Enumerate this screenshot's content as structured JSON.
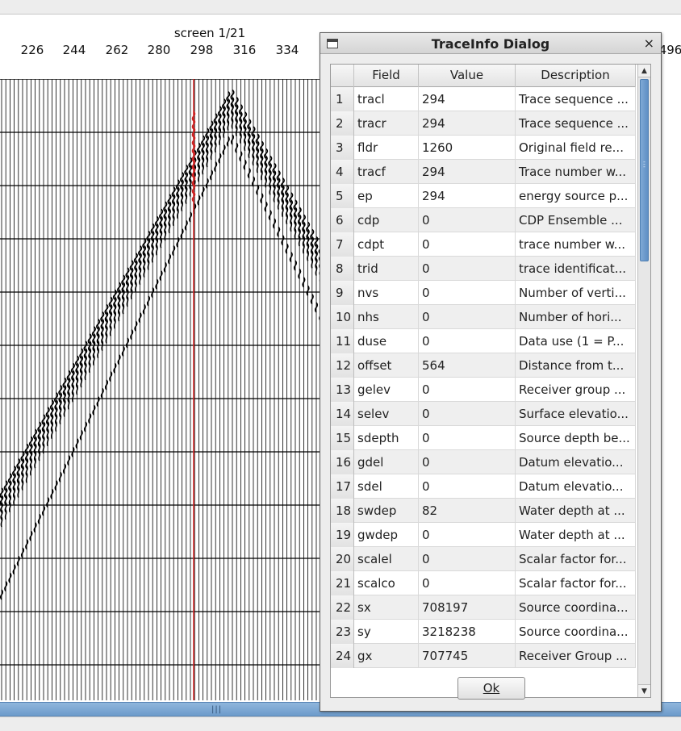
{
  "screen": {
    "title": "screen 1/21"
  },
  "axis": {
    "ticks": [
      "226",
      "244",
      "262",
      "280",
      "298",
      "316",
      "334",
      "496"
    ]
  },
  "dialog": {
    "title": "TraceInfo Dialog",
    "close_glyph": "×",
    "columns": [
      "Field",
      "Value",
      "Description"
    ],
    "rows": [
      {
        "n": "1",
        "field": "tracl",
        "value": "294",
        "desc": "Trace sequence ..."
      },
      {
        "n": "2",
        "field": "tracr",
        "value": "294",
        "desc": "Trace sequence ..."
      },
      {
        "n": "3",
        "field": "fldr",
        "value": "1260",
        "desc": "Original field re..."
      },
      {
        "n": "4",
        "field": "tracf",
        "value": "294",
        "desc": "Trace number w..."
      },
      {
        "n": "5",
        "field": "ep",
        "value": "294",
        "desc": "energy source p..."
      },
      {
        "n": "6",
        "field": "cdp",
        "value": "0",
        "desc": "CDP Ensemble ..."
      },
      {
        "n": "7",
        "field": "cdpt",
        "value": "0",
        "desc": "trace number w..."
      },
      {
        "n": "8",
        "field": "trid",
        "value": "0",
        "desc": "trace identificat..."
      },
      {
        "n": "9",
        "field": "nvs",
        "value": "0",
        "desc": "Number of verti..."
      },
      {
        "n": "10",
        "field": "nhs",
        "value": "0",
        "desc": "Number of hori..."
      },
      {
        "n": "11",
        "field": "duse",
        "value": "0",
        "desc": "Data use (1 = P..."
      },
      {
        "n": "12",
        "field": "offset",
        "value": "564",
        "desc": "Distance from t..."
      },
      {
        "n": "13",
        "field": "gelev",
        "value": "0",
        "desc": "Receiver group ..."
      },
      {
        "n": "14",
        "field": "selev",
        "value": "0",
        "desc": "Surface elevatio..."
      },
      {
        "n": "15",
        "field": "sdepth",
        "value": "0",
        "desc": "Source depth be..."
      },
      {
        "n": "16",
        "field": "gdel",
        "value": "0",
        "desc": "Datum elevatio..."
      },
      {
        "n": "17",
        "field": "sdel",
        "value": "0",
        "desc": "Datum elevatio..."
      },
      {
        "n": "18",
        "field": "swdep",
        "value": "82",
        "desc": "Water depth at ..."
      },
      {
        "n": "19",
        "field": "gwdep",
        "value": "0",
        "desc": "Water depth at ..."
      },
      {
        "n": "20",
        "field": "scalel",
        "value": "0",
        "desc": "Scalar factor for..."
      },
      {
        "n": "21",
        "field": "scalco",
        "value": "0",
        "desc": "Scalar factor for..."
      },
      {
        "n": "22",
        "field": "sx",
        "value": "708197",
        "desc": "Source coordina..."
      },
      {
        "n": "23",
        "field": "sy",
        "value": "3218238",
        "desc": "Source coordina..."
      },
      {
        "n": "24",
        "field": "gx",
        "value": "707745",
        "desc": "Receiver Group ..."
      }
    ],
    "ok_label": "Ok"
  },
  "colors": {
    "selected_trace": "#cc2222",
    "scroll_accent": "#6d9bcb"
  }
}
